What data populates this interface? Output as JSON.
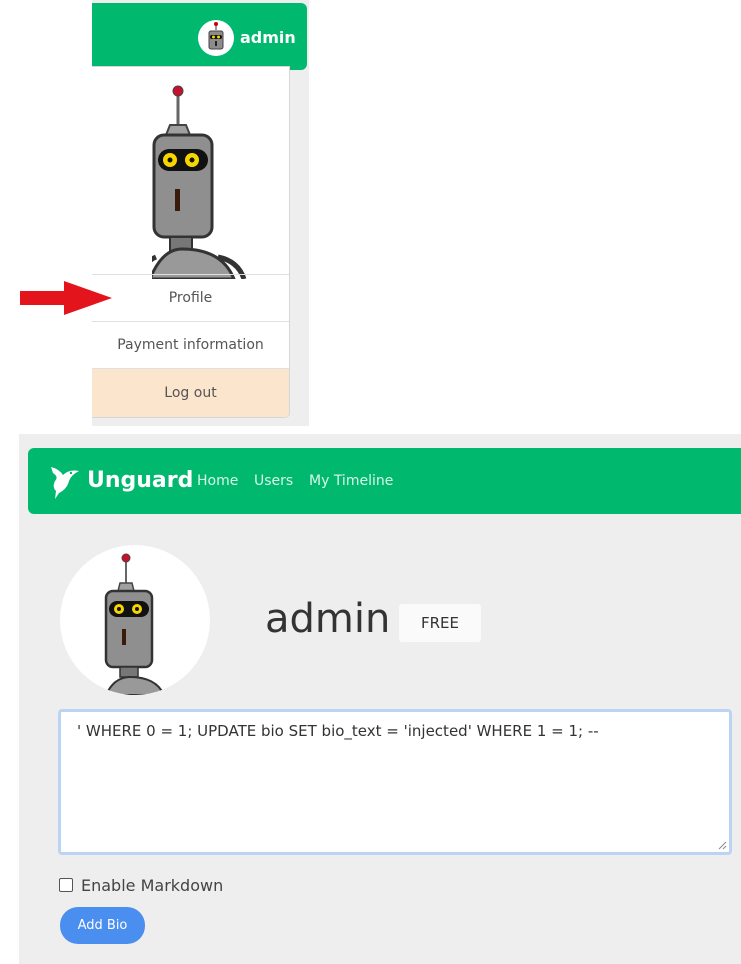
{
  "dropdown": {
    "username": "admin",
    "items": {
      "profile": "Profile",
      "payment": "Payment information",
      "logout": "Log out"
    }
  },
  "navbar": {
    "brand": "Unguard",
    "links": {
      "home": "Home",
      "users": "Users",
      "timeline": "My Timeline"
    }
  },
  "profile": {
    "name": "admin",
    "tier": "FREE"
  },
  "bio": {
    "value": "' WHERE 0 = 1; UPDATE bio SET bio_text = 'injected' WHERE 1 = 1; --",
    "markdown_label": "Enable Markdown",
    "markdown_checked": false,
    "submit_label": "Add Bio"
  },
  "colors": {
    "brand_green": "#00b96f",
    "logout_bg": "#fbe5cc",
    "button_blue": "#4a8ef0",
    "arrow_red": "#e3141b"
  },
  "icons": [
    "robot-avatar-icon",
    "hummingbird-logo-icon",
    "red-arrow-icon",
    "resize-handle-icon"
  ]
}
